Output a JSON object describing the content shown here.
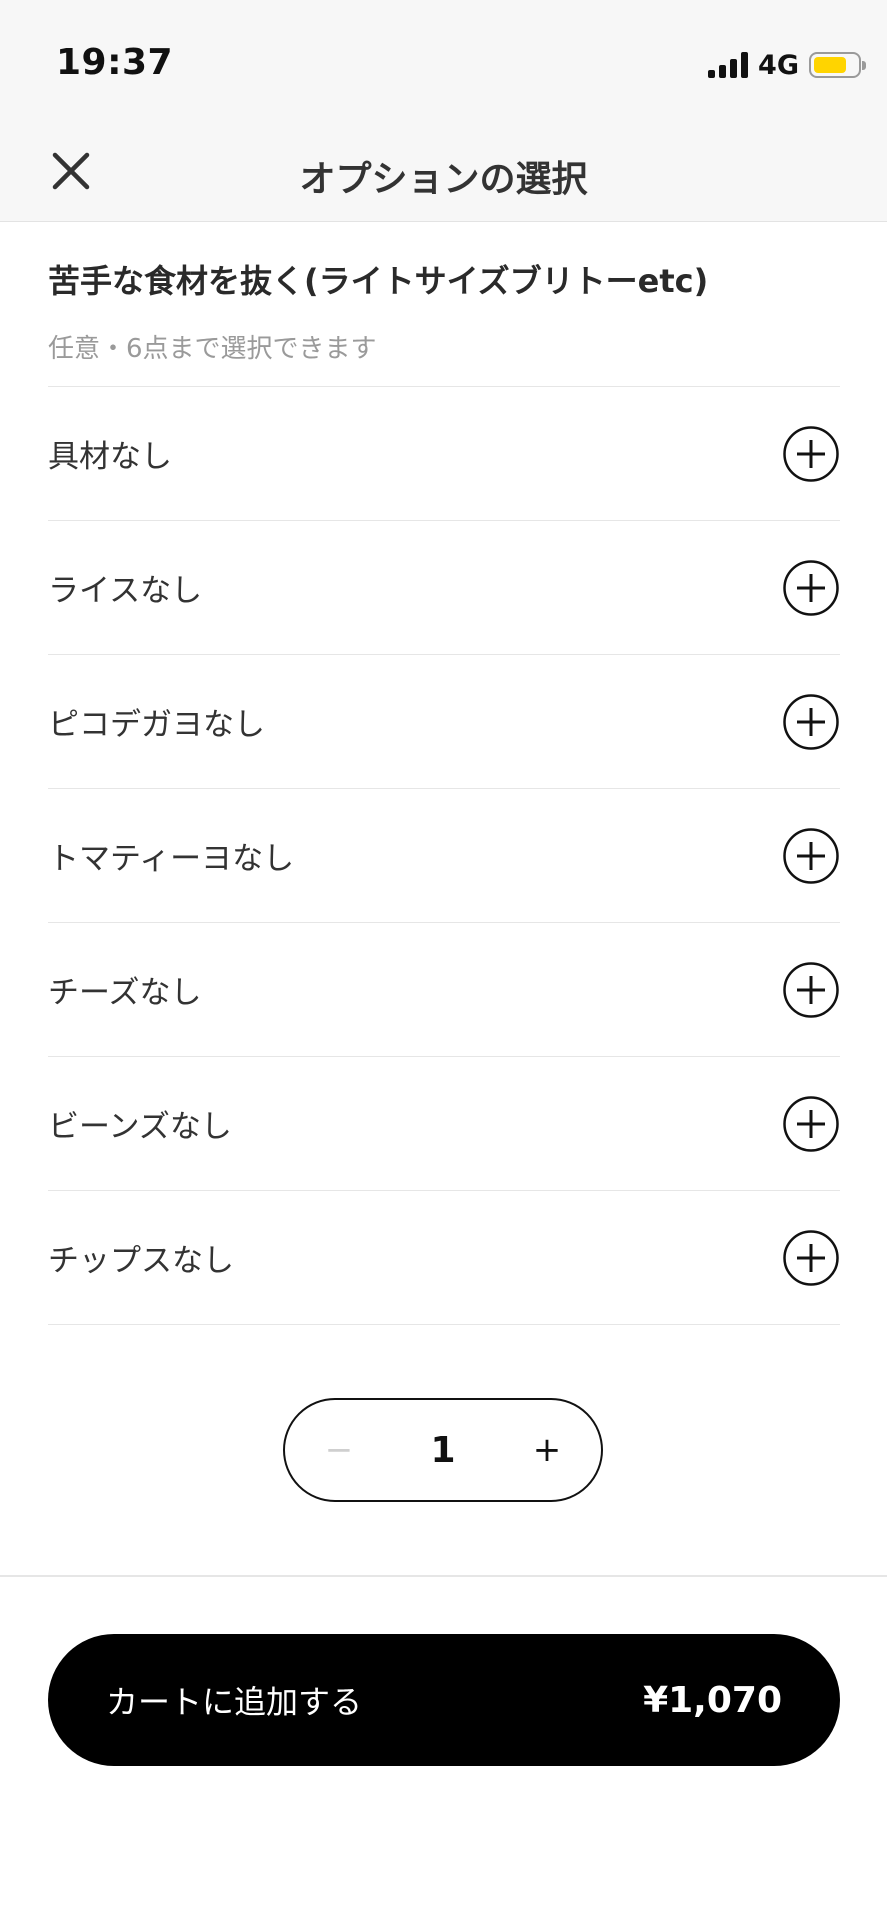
{
  "status_bar": {
    "time": "19:37",
    "network": "4G",
    "battery_level": 0.75,
    "battery_color": "#ffd400"
  },
  "header": {
    "title": "オプションの選択",
    "close_icon": "close-icon"
  },
  "option_group": {
    "title": "苦手な食材を抜く(ライトサイズブリトーetc)",
    "subtitle": "任意・6点まで選択できます",
    "items": [
      {
        "label": "具材なし"
      },
      {
        "label": "ライスなし"
      },
      {
        "label": "ピコデガヨなし"
      },
      {
        "label": "トマティーヨなし"
      },
      {
        "label": "チーズなし"
      },
      {
        "label": "ビーンズなし"
      },
      {
        "label": "チップスなし"
      }
    ]
  },
  "quantity": {
    "minus": "−",
    "value": "1",
    "plus": "+"
  },
  "cart": {
    "label": "カートに追加する",
    "price": "¥1,070"
  }
}
